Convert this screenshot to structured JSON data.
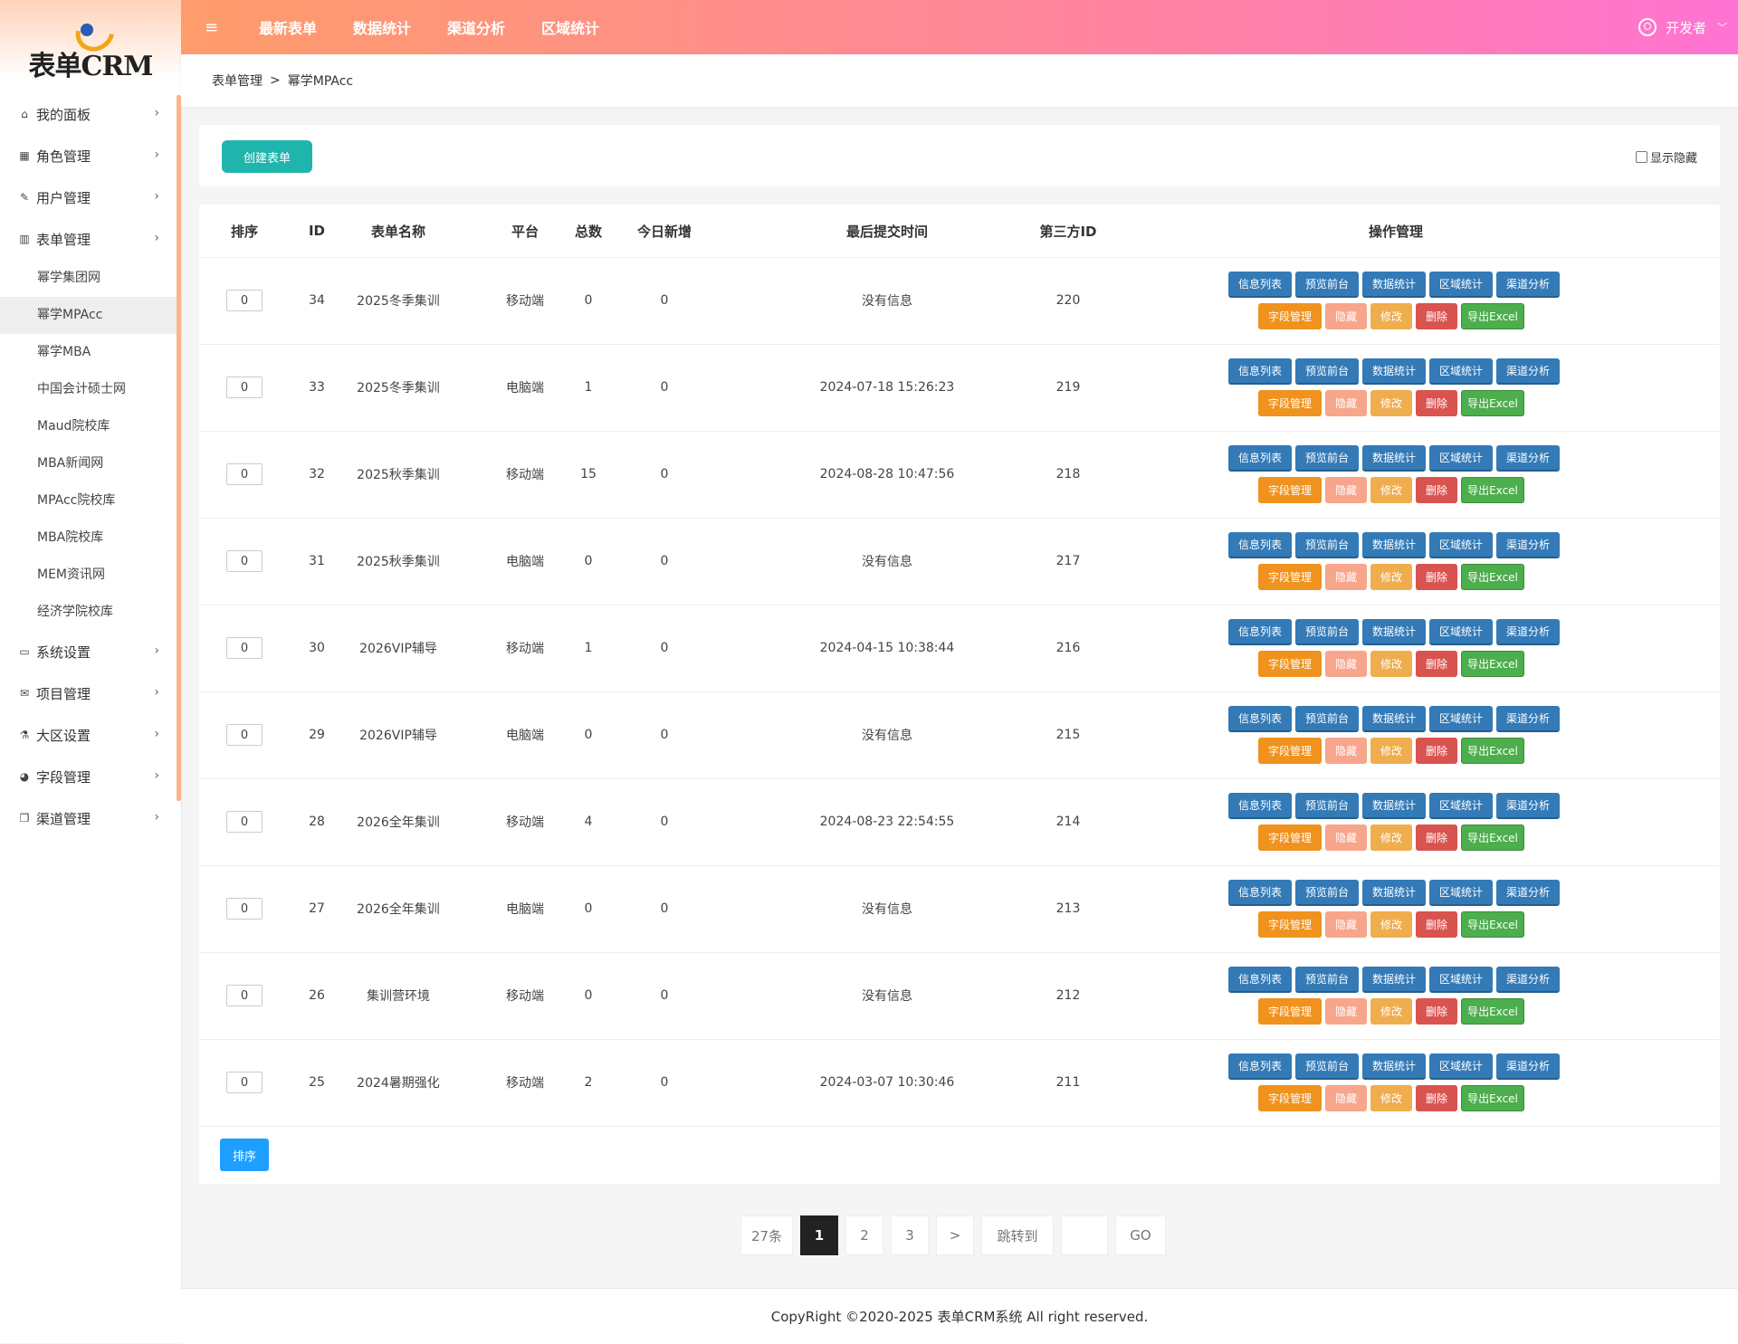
{
  "app": {
    "logo_text": "表单CRM"
  },
  "topbar": {
    "menu_icon": "hamburger-icon",
    "nav": [
      "最新表单",
      "数据统计",
      "渠道分析",
      "区域统计"
    ],
    "user_name": "开发者",
    "user_caret": "﹀"
  },
  "sidebar": {
    "items": [
      {
        "label": "我的面板",
        "icon": "home-icon",
        "glyph": "⌂"
      },
      {
        "label": "角色管理",
        "icon": "table-icon",
        "glyph": "▦"
      },
      {
        "label": "用户管理",
        "icon": "edit-icon",
        "glyph": "✎"
      },
      {
        "label": "表单管理",
        "icon": "bar-chart-icon",
        "glyph": "▥"
      }
    ],
    "sub_items": [
      "幂学集团网",
      "幂学MPAcc",
      "幂学MBA",
      "中国会计硕士网",
      "Maud院校库",
      "MBA新闻网",
      "MPAcc院校库",
      "MBA院校库",
      "MEM资讯网",
      "经济学院校库"
    ],
    "active_sub": "幂学MPAcc",
    "items2": [
      {
        "label": "系统设置",
        "icon": "desktop-icon",
        "glyph": "▭"
      },
      {
        "label": "项目管理",
        "icon": "envelope-icon",
        "glyph": "✉"
      },
      {
        "label": "大区设置",
        "icon": "flask-icon",
        "glyph": "⚗"
      },
      {
        "label": "字段管理",
        "icon": "pie-chart-icon",
        "glyph": "◕"
      },
      {
        "label": "渠道管理",
        "icon": "clone-icon",
        "glyph": "❐"
      }
    ]
  },
  "breadcrumb": {
    "parent": "表单管理",
    "separator": ">",
    "current": "幂学MPAcc"
  },
  "actions": {
    "create_label": "创建表单",
    "show_hidden_label": "显示隐藏"
  },
  "table": {
    "headers": [
      "排序",
      "ID",
      "表单名称",
      "平台",
      "总数",
      "今日新增",
      "最后提交时间",
      "第三方ID",
      "操作管理"
    ],
    "rows": [
      {
        "sort": "0",
        "id": "34",
        "name": "2025冬季集训",
        "platform": "移动端",
        "total": "0",
        "today": "0",
        "last": "没有信息",
        "third": "220"
      },
      {
        "sort": "0",
        "id": "33",
        "name": "2025冬季集训",
        "platform": "电脑端",
        "total": "1",
        "today": "0",
        "last": "2024-07-18 15:26:23",
        "third": "219"
      },
      {
        "sort": "0",
        "id": "32",
        "name": "2025秋季集训",
        "platform": "移动端",
        "total": "15",
        "today": "0",
        "last": "2024-08-28 10:47:56",
        "third": "218"
      },
      {
        "sort": "0",
        "id": "31",
        "name": "2025秋季集训",
        "platform": "电脑端",
        "total": "0",
        "today": "0",
        "last": "没有信息",
        "third": "217"
      },
      {
        "sort": "0",
        "id": "30",
        "name": "2026VIP辅导",
        "platform": "移动端",
        "total": "1",
        "today": "0",
        "last": "2024-04-15 10:38:44",
        "third": "216"
      },
      {
        "sort": "0",
        "id": "29",
        "name": "2026VIP辅导",
        "platform": "电脑端",
        "total": "0",
        "today": "0",
        "last": "没有信息",
        "third": "215"
      },
      {
        "sort": "0",
        "id": "28",
        "name": "2026全年集训",
        "platform": "移动端",
        "total": "4",
        "today": "0",
        "last": "2024-08-23 22:54:55",
        "third": "214"
      },
      {
        "sort": "0",
        "id": "27",
        "name": "2026全年集训",
        "platform": "电脑端",
        "total": "0",
        "today": "0",
        "last": "没有信息",
        "third": "213"
      },
      {
        "sort": "0",
        "id": "26",
        "name": "集训营环境",
        "platform": "移动端",
        "total": "0",
        "today": "0",
        "last": "没有信息",
        "third": "212"
      },
      {
        "sort": "0",
        "id": "25",
        "name": "2024暑期强化",
        "platform": "移动端",
        "total": "2",
        "today": "0",
        "last": "2024-03-07 10:30:46",
        "third": "211"
      }
    ],
    "row_actions_1": [
      "信息列表",
      "预览前台",
      "数据统计",
      "区域统计",
      "渠道分析"
    ],
    "row_actions_2": [
      "字段管理",
      "隐藏",
      "修改",
      "删除",
      "导出Excel"
    ],
    "sort_button": "排序"
  },
  "pagination": {
    "total": "27条",
    "pages": [
      "1",
      "2",
      "3"
    ],
    "current": "1",
    "next": ">",
    "jump_label": "跳转到",
    "jump_value": "",
    "go": "GO"
  },
  "footer": {
    "text": "CopyRight ©2020-2025 表单CRM系统 All right reserved."
  },
  "colors": {
    "accent_teal": "#1fb5ad",
    "primary_blue": "#1e9fff",
    "btn_blue": "#337ab7",
    "btn_orange": "#f0921e",
    "btn_salmon": "#f7a58b",
    "btn_yellow": "#f0ad4e",
    "btn_red": "#d9534f",
    "btn_green": "#4cae4c"
  }
}
